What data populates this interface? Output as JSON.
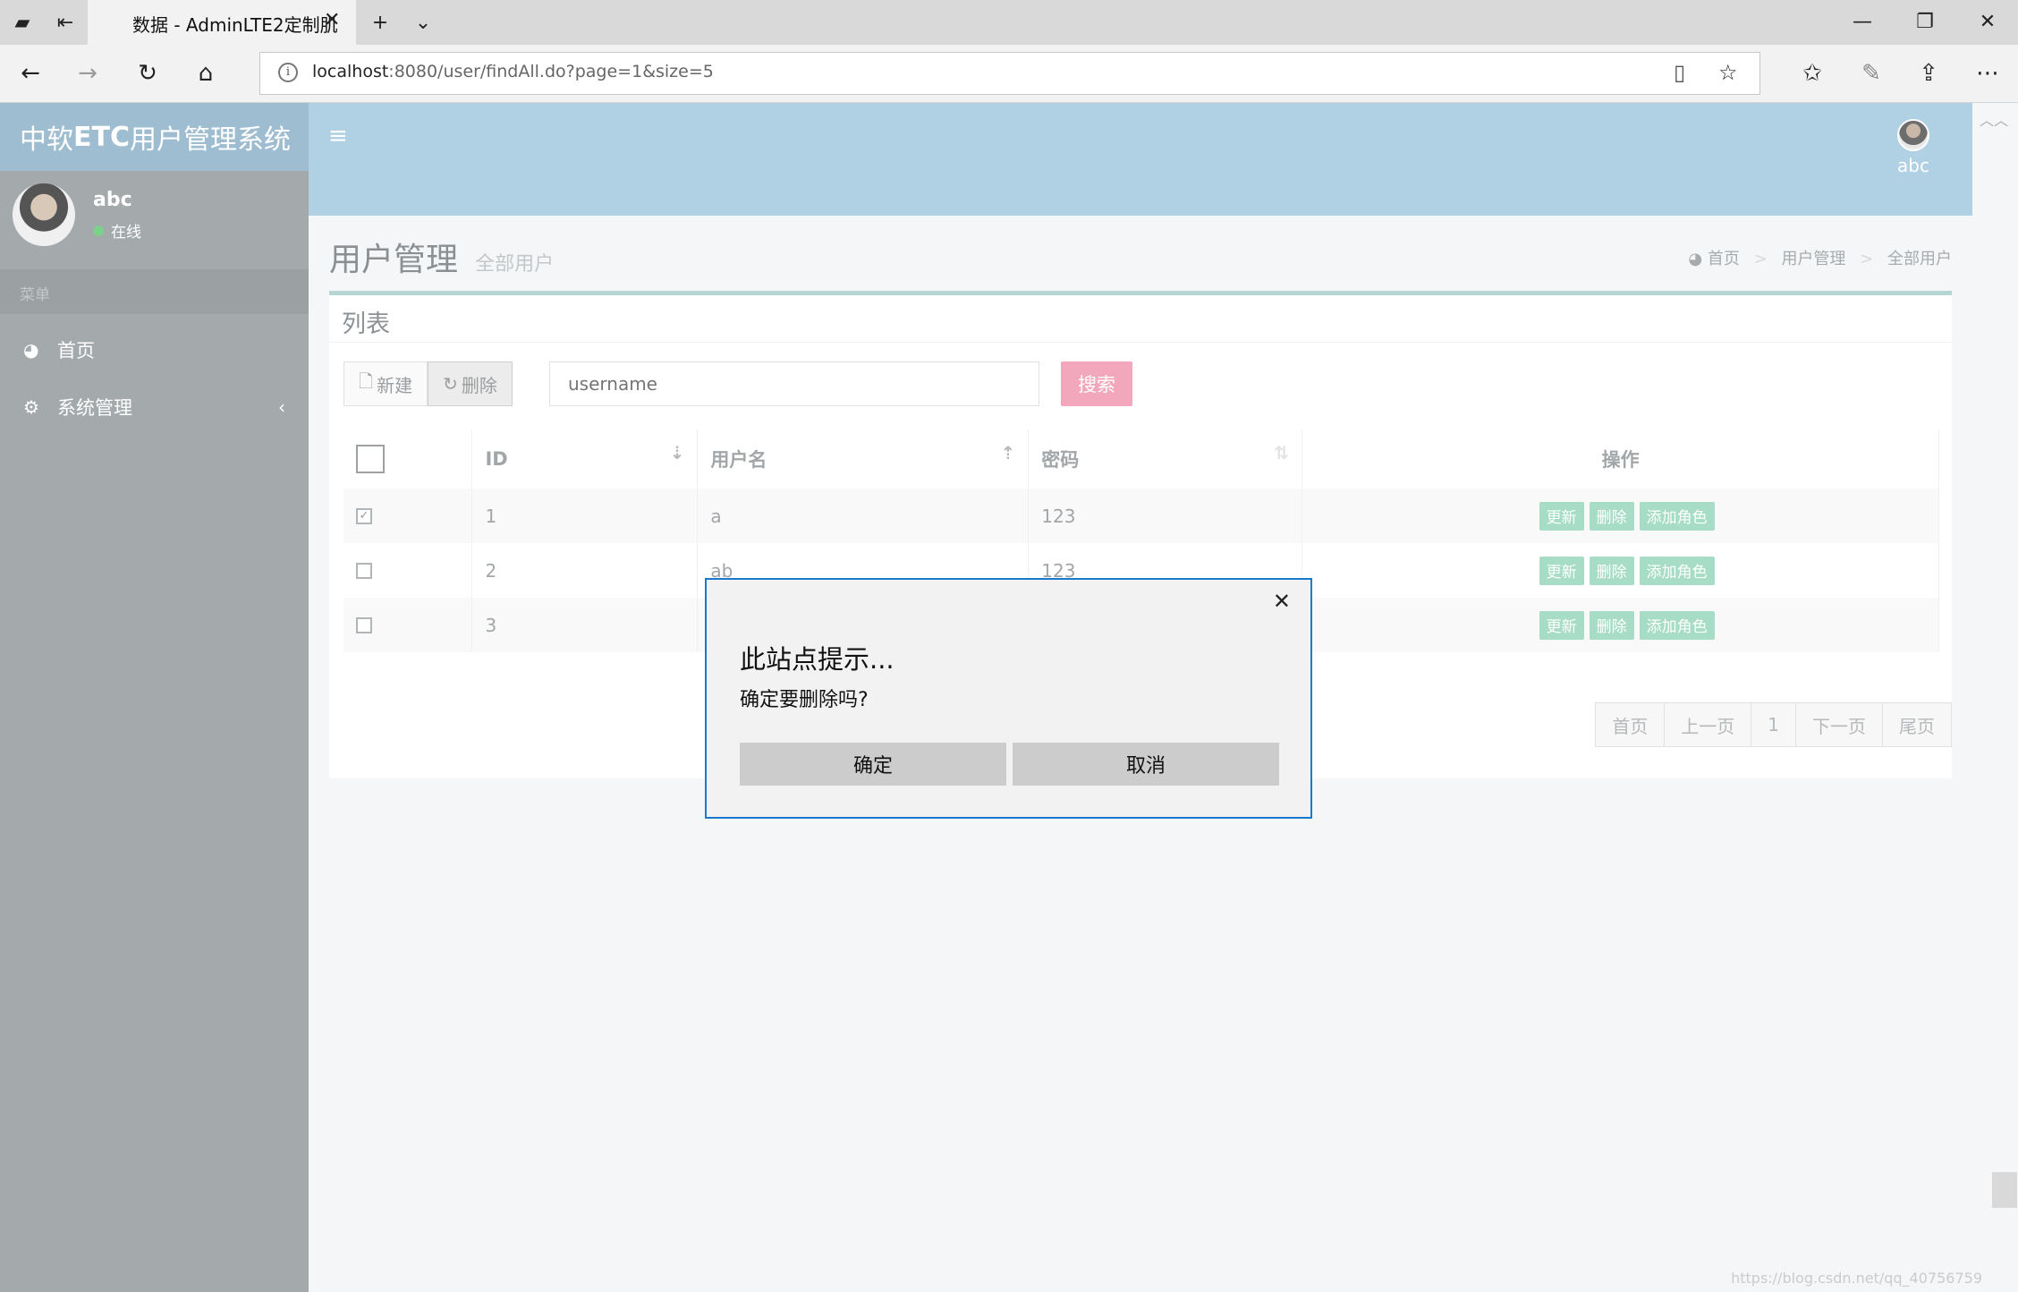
{
  "browser": {
    "tab_title": "数据 - AdminLTE2定制肌",
    "url_host": "localhost",
    "url_rest": ":8080/user/findAll.do?page=1&size=5"
  },
  "app": {
    "logo_pre": "中软",
    "logo_bold": "ETC",
    "logo_post": "用户管理系统",
    "top_user_name": "abc"
  },
  "sidebar": {
    "user_name": "abc",
    "user_status": "在线",
    "header": "菜单",
    "items": [
      {
        "label": "首页",
        "icon": "dashboard-icon"
      },
      {
        "label": "系统管理",
        "icon": "gears-icon"
      }
    ]
  },
  "content": {
    "title": "用户管理",
    "subtitle": "全部用户",
    "breadcrumb": [
      "首页",
      "用户管理",
      "全部用户"
    ]
  },
  "box": {
    "title": "列表",
    "new_label": "新建",
    "delete_label": "删除",
    "search_placeholder": "username",
    "search_label": "搜索"
  },
  "table": {
    "columns": [
      "ID",
      "用户名",
      "密码",
      "操作"
    ],
    "rows": [
      {
        "id": "1",
        "username": "a",
        "password": "123",
        "checked": true
      },
      {
        "id": "2",
        "username": "ab",
        "password": "123",
        "checked": false
      },
      {
        "id": "3",
        "username": "",
        "password": "",
        "checked": false
      }
    ],
    "actions": [
      "更新",
      "删除",
      "添加角色"
    ]
  },
  "pagination": [
    "首页",
    "上一页",
    "1",
    "下一页",
    "尾页"
  ],
  "dialog": {
    "title": "此站点提示...",
    "message": "确定要删除吗?",
    "ok_label": "确定",
    "cancel_label": "取消"
  },
  "watermark": "https://blog.csdn.net/qq_40756759"
}
